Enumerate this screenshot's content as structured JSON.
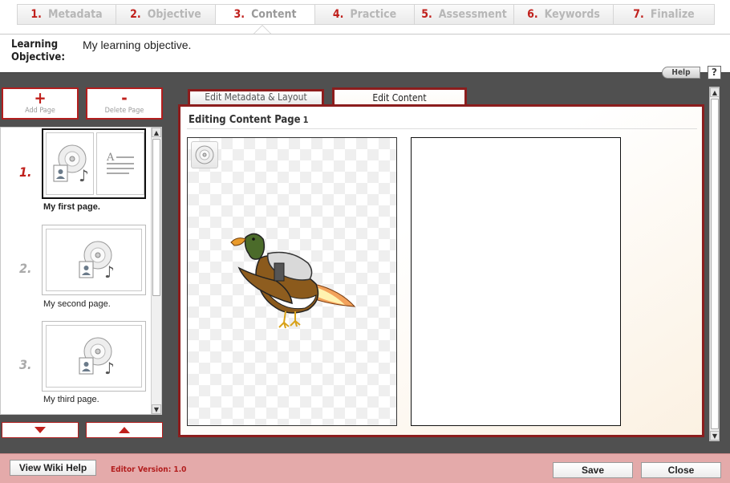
{
  "steps": [
    {
      "num": "1.",
      "label": "Metadata"
    },
    {
      "num": "2.",
      "label": "Objective"
    },
    {
      "num": "3.",
      "label": "Content"
    },
    {
      "num": "4.",
      "label": "Practice"
    },
    {
      "num": "5.",
      "label": "Assessment"
    },
    {
      "num": "6.",
      "label": "Keywords"
    },
    {
      "num": "7.",
      "label": "Finalize"
    }
  ],
  "active_step": "Content",
  "objective": {
    "label": "Learning Objective:",
    "text": "My learning objective."
  },
  "help": {
    "label": "Help",
    "icon_text": "?"
  },
  "page_actions": {
    "add_symbol": "+",
    "add_label": "Add Page",
    "delete_symbol": "-",
    "delete_label": "Delete Page"
  },
  "pages": [
    {
      "num": "1.",
      "title": "My first page.",
      "active": true
    },
    {
      "num": "2.",
      "title": "My second page.",
      "active": false
    },
    {
      "num": "3.",
      "title": "My third page.",
      "active": false
    }
  ],
  "tabs": {
    "metadata": "Edit Metadata & Layout",
    "content": "Edit Content"
  },
  "content": {
    "title": "Editing Content Page",
    "page_number": "1"
  },
  "footer": {
    "wiki_help": "View Wiki Help",
    "version": "Editor Version: 1.0",
    "save": "Save",
    "close": "Close"
  },
  "colors": {
    "accent": "#b21e1e",
    "workspace": "#505050",
    "footer": "#e4aaaa"
  }
}
